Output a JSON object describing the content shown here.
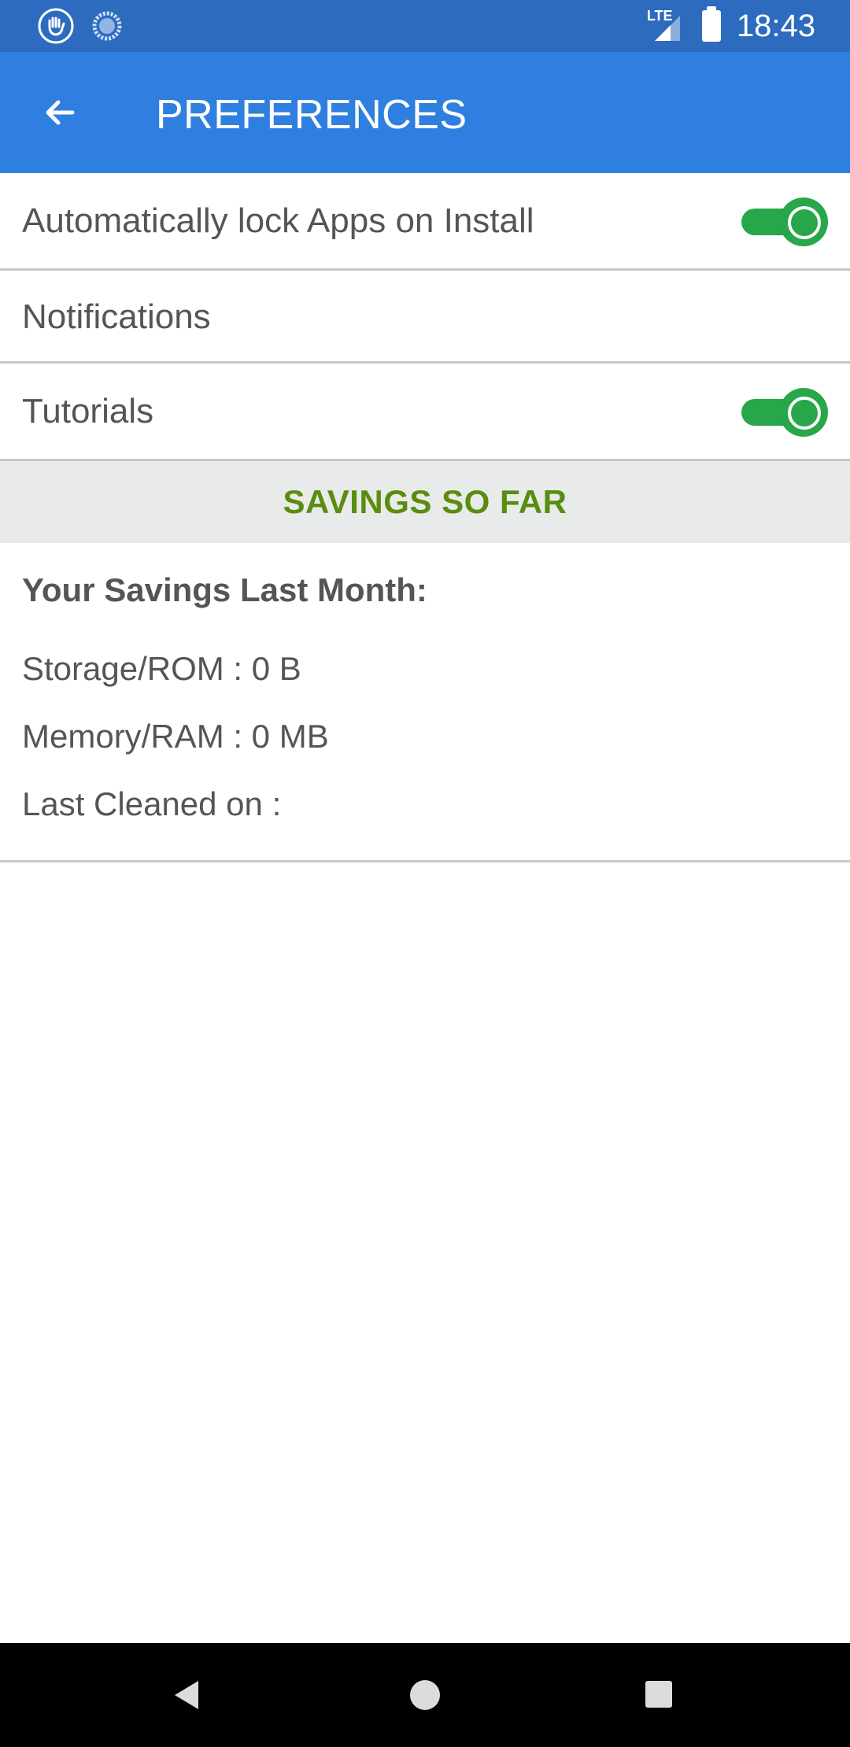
{
  "status_bar": {
    "time": "18:43",
    "network": "LTE",
    "left_icons": [
      "hand-icon",
      "loading-icon"
    ],
    "right_icons": [
      "lte-signal-icon",
      "battery-icon"
    ]
  },
  "app_bar": {
    "title": "PREFERENCES",
    "back_icon": "arrow-left-icon"
  },
  "preferences": [
    {
      "label": "Automatically lock Apps on Install",
      "toggle": true,
      "enabled": true
    },
    {
      "label": "Notifications",
      "toggle": false
    },
    {
      "label": "Tutorials",
      "toggle": true,
      "enabled": true
    }
  ],
  "savings": {
    "section_title": "SAVINGS SO FAR",
    "heading": "Your Savings Last Month:",
    "storage": "Storage/ROM : 0 B",
    "memory": "Memory/RAM : 0 MB",
    "last_cleaned": "Last Cleaned on :"
  },
  "nav_bar": {
    "buttons": [
      "back-icon",
      "home-icon",
      "recents-icon"
    ]
  },
  "colors": {
    "status_bar": "#2d6bbf",
    "app_bar": "#2e7fe0",
    "toggle_on": "#27a64a",
    "section_title": "#5a8d0f",
    "section_bg": "#e8ebea"
  }
}
